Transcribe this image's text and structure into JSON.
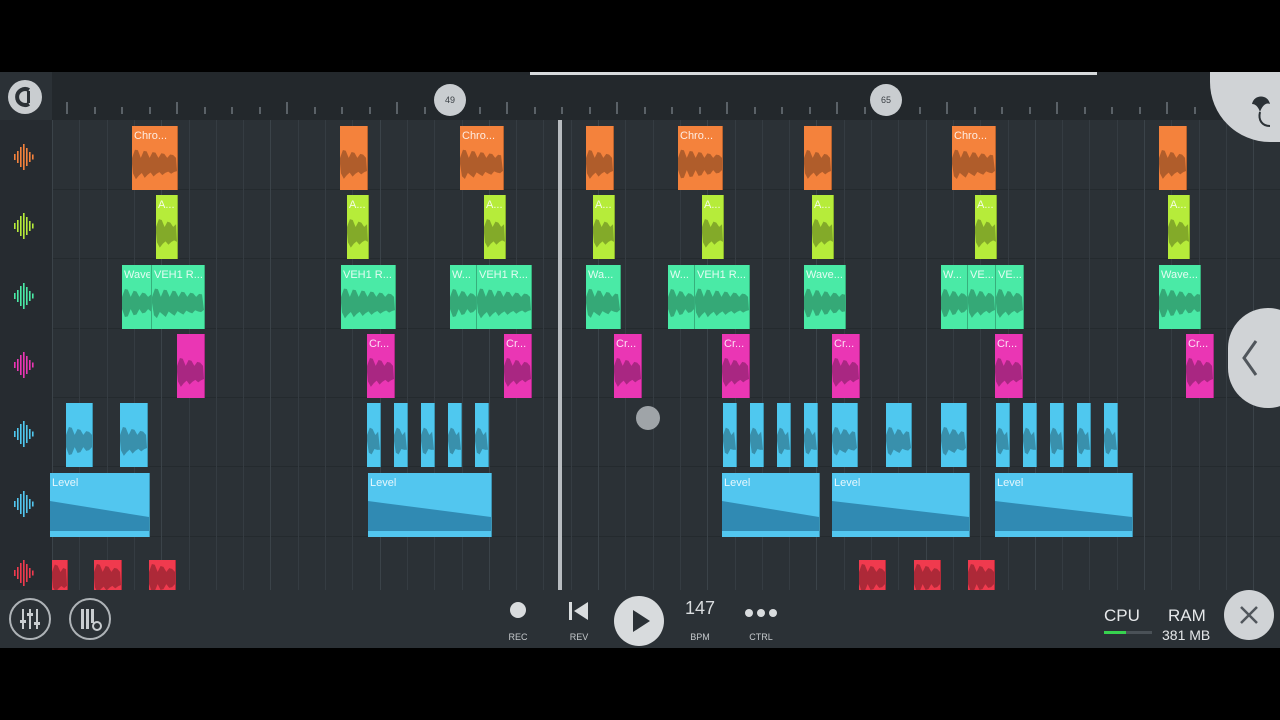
{
  "timeline": {
    "markers": [
      "49",
      "65"
    ]
  },
  "tracks": [
    {
      "color": "#f4823c",
      "clips": [
        {
          "label": "Chro..."
        },
        {
          "label": ""
        },
        {
          "label": "Chro..."
        },
        {
          "label": ""
        },
        {
          "label": "Chro..."
        },
        {
          "label": ""
        },
        {
          "label": "Chro..."
        },
        {
          "label": ""
        }
      ]
    },
    {
      "color": "#b6ec3a",
      "clips": [
        {
          "label": "A..."
        },
        {
          "label": "A..."
        },
        {
          "label": "A..."
        },
        {
          "label": "A..."
        },
        {
          "label": "A..."
        },
        {
          "label": "A..."
        },
        {
          "label": "A..."
        },
        {
          "label": "A..."
        }
      ]
    },
    {
      "color": "#4aeaa6",
      "clips": [
        {
          "label": "Wave"
        },
        {
          "label": "VEH1 R..."
        },
        {
          "label": "VEH1 R..."
        },
        {
          "label": "W..."
        },
        {
          "label": "VEH1 R..."
        },
        {
          "label": "Wa..."
        },
        {
          "label": "W..."
        },
        {
          "label": "VEH1 R..."
        },
        {
          "label": "Wave..."
        },
        {
          "label": "W..."
        },
        {
          "label": "VE..."
        },
        {
          "label": "VE..."
        },
        {
          "label": "Wave..."
        }
      ]
    },
    {
      "color": "#ea36b4",
      "clips": [
        {
          "label": ""
        },
        {
          "label": "Cr..."
        },
        {
          "label": "Cr..."
        },
        {
          "label": "Cr..."
        },
        {
          "label": "Cr..."
        },
        {
          "label": "Cr..."
        },
        {
          "label": "Cr..."
        },
        {
          "label": "Cr..."
        }
      ]
    },
    {
      "color": "#4fc8ef",
      "clips": []
    },
    {
      "color": "#52c6ef",
      "clips": [
        {
          "label": "Level"
        },
        {
          "label": "Level"
        },
        {
          "label": "Level"
        },
        {
          "label": "Level"
        },
        {
          "label": "Level"
        }
      ]
    },
    {
      "color": "#f03a4e",
      "clips": []
    }
  ],
  "transport": {
    "rec": "REC",
    "rev": "REV",
    "bpm_value": "147",
    "bpm_label": "BPM",
    "ctrl": "CTRL",
    "cpu_label": "CPU",
    "ram_label": "RAM",
    "ram_value": "381 MB"
  },
  "icons": [
    "fl-logo-icon",
    "mixer-icon",
    "piano-settings-icon",
    "record-icon",
    "rewind-icon",
    "play-icon",
    "more-icon",
    "close-icon",
    "chevron-left-icon",
    "fruit-logo-icon",
    "waveform-icon"
  ]
}
